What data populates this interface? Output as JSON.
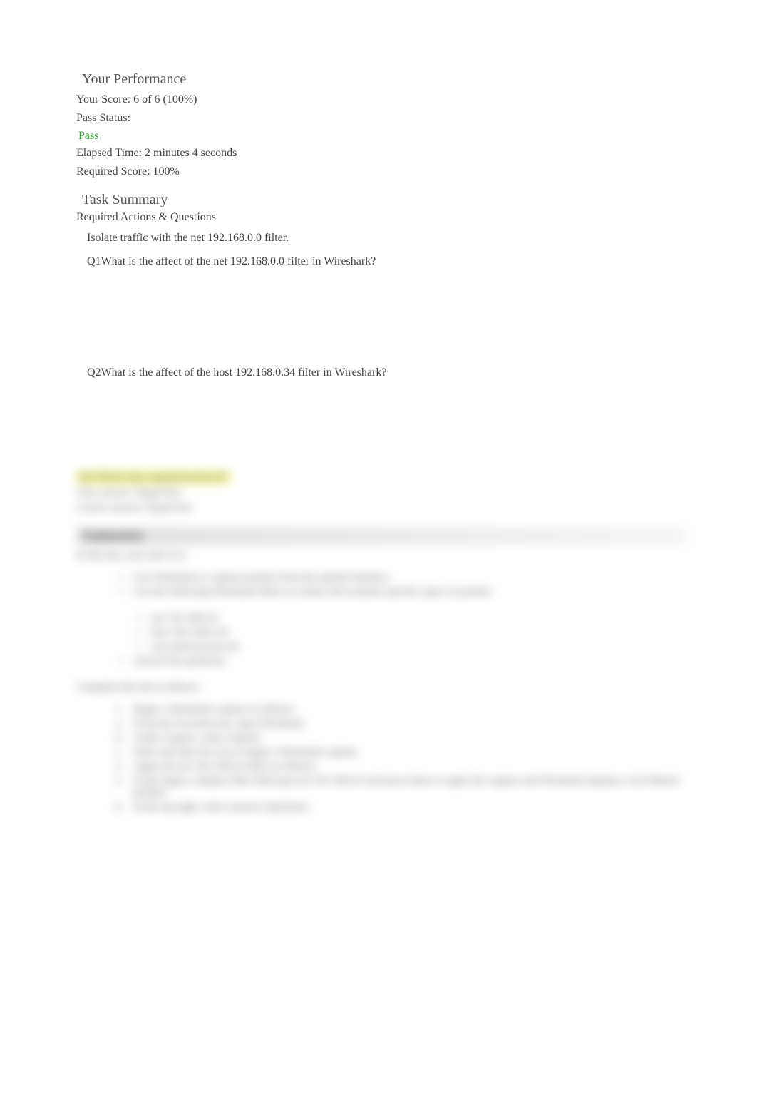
{
  "performance": {
    "title": "Your Performance",
    "score_line": "Your Score: 6 of 6 (100%)",
    "pass_status_label": "Pass Status:",
    "pass_status_value": "Pass",
    "elapsed_time": "Elapsed Time: 2 minutes 4 seconds",
    "required_score": "Required Score: 100%"
  },
  "task_summary": {
    "title": "Task Summary",
    "subsection": "Required Actions & Questions",
    "action1": "Isolate traffic with the net 192.168.0.0 filter.",
    "q1_label": "Q1",
    "q1_text": "What is the affect of the net 192.168.0.0 filter in Wireshark?",
    "q2_label": "Q2",
    "q2_text": "What is the affect of the host 192.168.0.34 filter in Wireshark?"
  },
  "blurred": {
    "highlighted": "Q3 Which only captured protocol?",
    "your_answer": "Your answer: HyperText",
    "correct_answer": "Correct answer: HyperText",
    "explanation_header": "Explanation",
    "explanation_intro": "In this lab, your task is to:",
    "task_list": {
      "item1": "Use Wireshark to capture packets from the enp2s0 interface.",
      "item2": "Use the following Wireshark filters to isolate and examine specific types of packets:",
      "sub1": "net 192.168.0.0",
      "sub2": "host 192.168.0.34",
      "sub3": "tcp (which protocol)",
      "item3": "Answer the questions."
    },
    "complete_title": "Complete this lab as follows:",
    "steps": {
      "step1": "Begin a Wireshark capture as follows:",
      "step1a": "From the Favorites bar, open Wireshark.",
      "step1b": "Under Capture, select enp2s0.",
      "step1c": "Select the blue fin icon to begin a Wireshark capture.",
      "step2": "Apply the net 192.168.0.0 filter as follows:",
      "step2a": "In the Apply a display filter field type net 192.168.0.0 and press Enter to apply the capture and Wireshark displays a list filtered packets.",
      "step2b": "In the top right, select Answer Questions."
    }
  }
}
